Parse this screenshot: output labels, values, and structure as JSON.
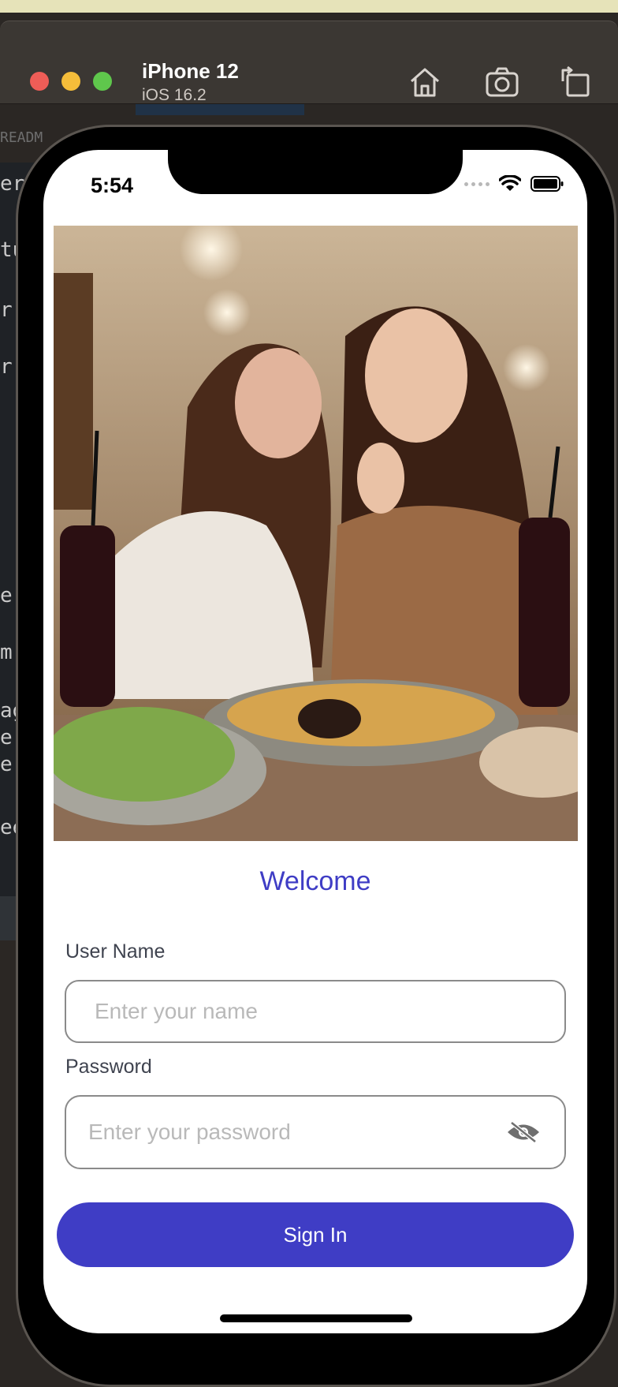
{
  "simulator": {
    "device_name": "iPhone 12",
    "os_version": "iOS 16.2",
    "toolbar_icons": [
      "home-icon",
      "screenshot-icon",
      "rotate-icon"
    ]
  },
  "background_editor": {
    "tab_text": "READM",
    "fragments": [
      "er",
      "tu",
      "r",
      "r",
      "e",
      "m",
      "ag",
      "e",
      "e",
      "ee"
    ]
  },
  "status_bar": {
    "time": "5:54",
    "icons": [
      "signal-icon",
      "wifi-icon",
      "battery-icon"
    ]
  },
  "hero_image": {
    "icon": "photo-two-women-eating-fries"
  },
  "login": {
    "title": "Welcome",
    "username_label": "User Name",
    "username_placeholder": "Enter your name",
    "username_value": "",
    "password_label": "Password",
    "password_placeholder": "Enter your password",
    "password_value": "",
    "password_toggle_icon": "eye-slash-icon",
    "signin_label": "Sign In"
  },
  "colors": {
    "accent": "#3f3dc5",
    "input_border": "#8a8a8a",
    "placeholder": "#b9b9b9"
  }
}
